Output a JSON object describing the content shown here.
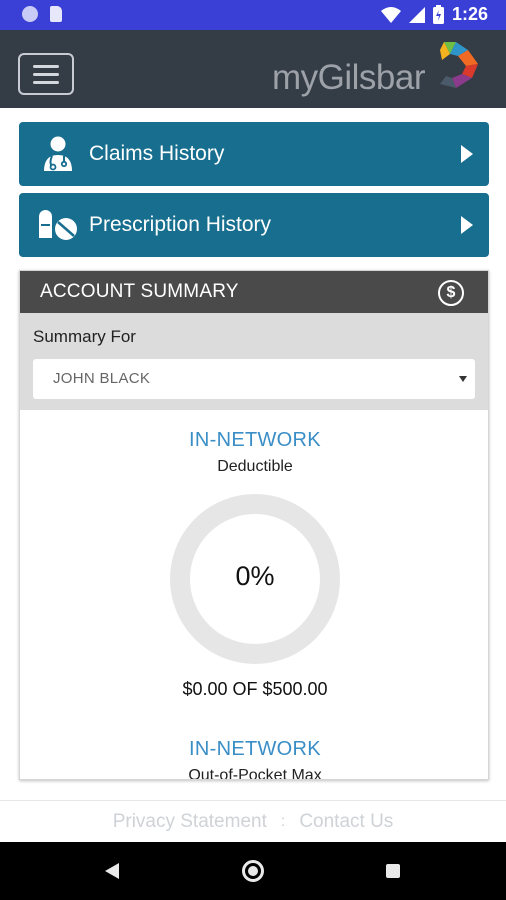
{
  "status_bar": {
    "time": "1:26"
  },
  "app": {
    "logo_text": "myGilsbar"
  },
  "nav_buttons": [
    {
      "label": "Claims History",
      "icon": "doctor-icon"
    },
    {
      "label": "Prescription History",
      "icon": "pills-icon"
    }
  ],
  "account_summary": {
    "title": "ACCOUNT SUMMARY",
    "summary_for_label": "Summary For",
    "selected_member": "JOHN BLACK",
    "metrics": [
      {
        "network": "IN-NETWORK",
        "type": "Deductible",
        "percent": 0,
        "percent_label": "0%",
        "amount_text": "$0.00 OF $500.00"
      },
      {
        "network": "IN-NETWORK",
        "type": "Out-of-Pocket Max"
      }
    ]
  },
  "footer": {
    "privacy": "Privacy Statement",
    "separator": ":",
    "contact": "Contact Us"
  },
  "colors": {
    "status_bar": "#3a3fd6",
    "app_bar": "#343c46",
    "nav_button": "#176e8e",
    "summary_header": "#4a4a4a",
    "accent_blue": "#3a8ec6",
    "donut_track": "#e6e6e6"
  }
}
